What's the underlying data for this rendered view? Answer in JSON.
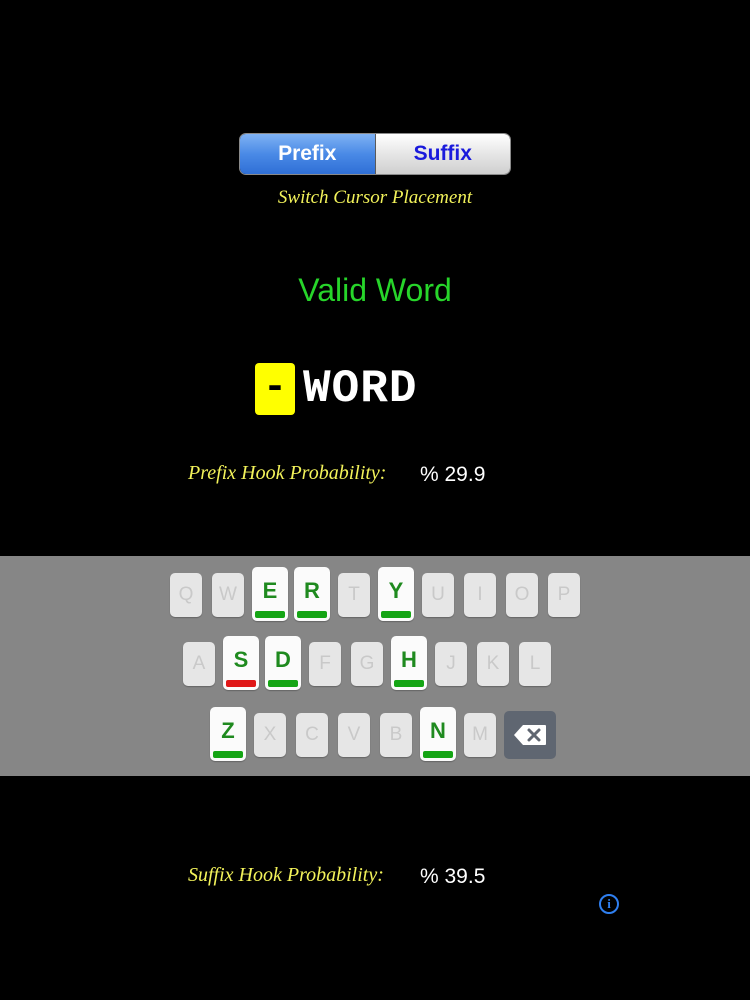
{
  "segmented": {
    "prefix_label": "Prefix",
    "suffix_label": "Suffix",
    "selected": "Prefix"
  },
  "switch_caption": "Switch Cursor Placement",
  "status_text": "Valid Word",
  "cursor_glyph": "-",
  "word": "WORD",
  "prefix_hook": {
    "label": "Prefix Hook Probability:",
    "value": "% 29.9"
  },
  "suffix_hook": {
    "label": "Suffix Hook Probability:",
    "value": "% 39.5"
  },
  "colors": {
    "background": "#000000",
    "accent_yellow": "#f2f25a",
    "valid_green": "#27d52a",
    "cursor_yellow": "#ffff00",
    "hook_bar_green": "#15a515",
    "hook_bar_red": "#e01818",
    "info_blue": "#2f7ff0"
  },
  "keyboard": {
    "rows": [
      [
        {
          "letter": "Q",
          "hook": false
        },
        {
          "letter": "W",
          "hook": false
        },
        {
          "letter": "E",
          "hook": true,
          "bar": "green"
        },
        {
          "letter": "R",
          "hook": true,
          "bar": "green"
        },
        {
          "letter": "T",
          "hook": false
        },
        {
          "letter": "Y",
          "hook": true,
          "bar": "green"
        },
        {
          "letter": "U",
          "hook": false
        },
        {
          "letter": "I",
          "hook": false
        },
        {
          "letter": "O",
          "hook": false
        },
        {
          "letter": "P",
          "hook": false
        }
      ],
      [
        {
          "letter": "A",
          "hook": false
        },
        {
          "letter": "S",
          "hook": true,
          "bar": "red"
        },
        {
          "letter": "D",
          "hook": true,
          "bar": "green"
        },
        {
          "letter": "F",
          "hook": false
        },
        {
          "letter": "G",
          "hook": false
        },
        {
          "letter": "H",
          "hook": true,
          "bar": "green"
        },
        {
          "letter": "J",
          "hook": false
        },
        {
          "letter": "K",
          "hook": false
        },
        {
          "letter": "L",
          "hook": false
        }
      ],
      [
        {
          "letter": "Z",
          "hook": true,
          "bar": "green"
        },
        {
          "letter": "X",
          "hook": false
        },
        {
          "letter": "C",
          "hook": false
        },
        {
          "letter": "V",
          "hook": false
        },
        {
          "letter": "B",
          "hook": false
        },
        {
          "letter": "N",
          "hook": true,
          "bar": "green"
        },
        {
          "letter": "M",
          "hook": false
        }
      ]
    ],
    "backspace_icon": "backspace-icon"
  },
  "info_icon": "info-icon"
}
